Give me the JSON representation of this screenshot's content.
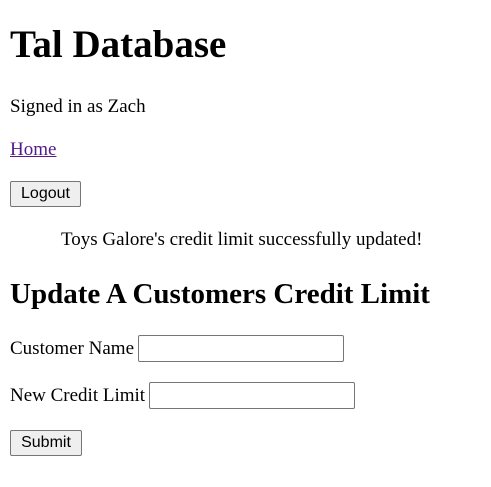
{
  "header": {
    "title": "Tal Database",
    "signed_in_text": "Signed in as Zach",
    "home_link": "Home",
    "logout_label": "Logout"
  },
  "status": {
    "message": "Toys Galore's credit limit successfully updated!"
  },
  "form": {
    "heading": "Update A Customers Credit Limit",
    "customer_name_label": "Customer Name",
    "customer_name_value": "",
    "new_limit_label": "New Credit Limit",
    "new_limit_value": "",
    "submit_label": "Submit"
  }
}
